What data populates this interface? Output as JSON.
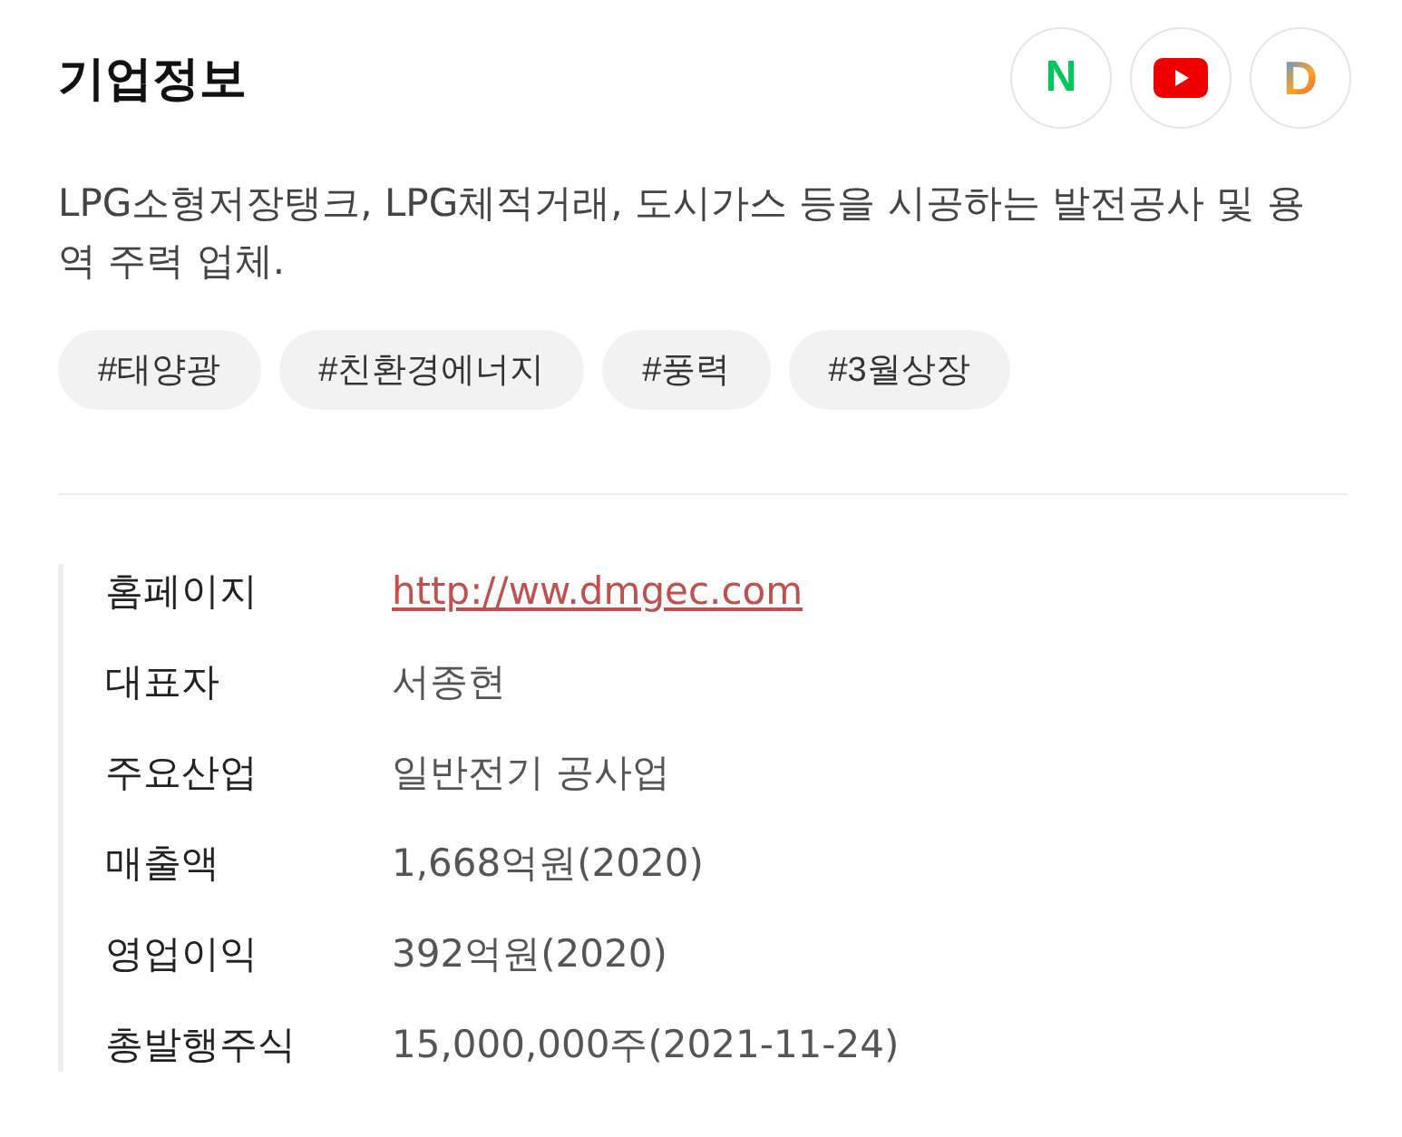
{
  "title": "기업정보",
  "links": [
    {
      "kind": "naver",
      "label": "N"
    },
    {
      "kind": "youtube"
    },
    {
      "kind": "daum",
      "label": "D"
    }
  ],
  "description": "LPG소형저장탱크, LPG체적거래, 도시가스 등을 시공하는 발전공사 및 용역 주력 업체.",
  "tags": [
    "#태양광",
    "#친환경에너지",
    "#풍력",
    "#3월상장"
  ],
  "info": [
    {
      "label": "홈페이지",
      "value": "http://ww.dmgec.com",
      "kind": "link"
    },
    {
      "label": "대표자",
      "value": "서종현",
      "kind": "text"
    },
    {
      "label": "주요산업",
      "value": "일반전기 공사업",
      "kind": "text"
    },
    {
      "label": "매출액",
      "value": "1,668억원(2020)",
      "kind": "text"
    },
    {
      "label": "영업이익",
      "value": "392억원(2020)",
      "kind": "text"
    },
    {
      "label": "총발행주식",
      "value": "15,000,000주(2021-11-24)",
      "kind": "text"
    }
  ]
}
